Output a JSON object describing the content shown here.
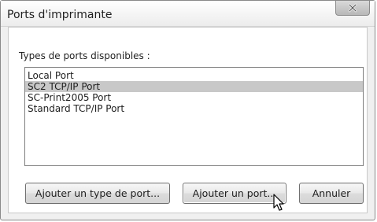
{
  "window": {
    "title": "Ports d'imprimante",
    "close_icon": "close-x-icon"
  },
  "list": {
    "label": "Types de ports disponibles :",
    "items": [
      {
        "label": "Local Port",
        "selected": false
      },
      {
        "label": "SC2 TCP/IP Port",
        "selected": true
      },
      {
        "label": "SC-Print2005 Port",
        "selected": false
      },
      {
        "label": "Standard TCP/IP Port",
        "selected": false
      }
    ]
  },
  "buttons": {
    "add_port_type": "Ajouter un type de port...",
    "add_port": "Ajouter un port...",
    "cancel": "Annuler"
  },
  "cursor_icon": "mouse-pointer-icon"
}
